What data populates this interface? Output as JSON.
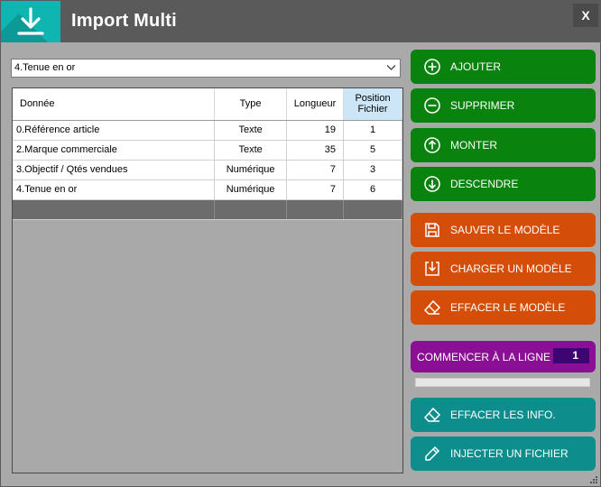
{
  "window": {
    "title": "Import Multi",
    "close_label": "X"
  },
  "selector": {
    "value": "4.Tenue en or"
  },
  "table": {
    "headers": [
      "Donnée",
      "Type",
      "Longueur",
      "Position Fichier"
    ],
    "header_pos_line1": "Position",
    "header_pos_line2": "Fichier",
    "rows": [
      [
        "0.Référence article",
        "Texte",
        "19",
        "1"
      ],
      [
        "2.Marque commerciale",
        "Texte",
        "35",
        "5"
      ],
      [
        "3.Objectif / Qtés vendues",
        "Numérique",
        "7",
        "3"
      ],
      [
        "4.Tenue en or",
        "Numérique",
        "7",
        "6"
      ]
    ]
  },
  "buttons": {
    "add": "AJOUTER",
    "remove": "SUPPRIMER",
    "up": "MONTER",
    "down": "DESCENDRE",
    "save_model": "SAUVER LE MODÈLE",
    "load_model": "CHARGER UN MODÈLE",
    "clear_model": "EFFACER LE MODÈLE",
    "clear_info": "EFFACER LES INFO.",
    "inject_file": "INJECTER UN FICHIER"
  },
  "start_line": {
    "label": "COMMENCER À LA LIGNE",
    "value": "1"
  },
  "progress": {
    "fraction": 0
  },
  "colors": {
    "green": "#0a820e",
    "orange": "#d44e0a",
    "teal": "#0d8e8c",
    "purple": "#8b0f94",
    "logo": "#0fb5b0",
    "titlebar": "#5a5a5a"
  },
  "icons": {
    "logo": "arrow-down-icon",
    "add": "plus-circle-icon",
    "remove": "minus-circle-icon",
    "up": "arrow-up-circle-icon",
    "down": "arrow-down-circle-icon",
    "save": "floppy-disk-icon",
    "load": "download-box-icon",
    "clear": "eraser-icon",
    "inject": "pen-icon"
  }
}
